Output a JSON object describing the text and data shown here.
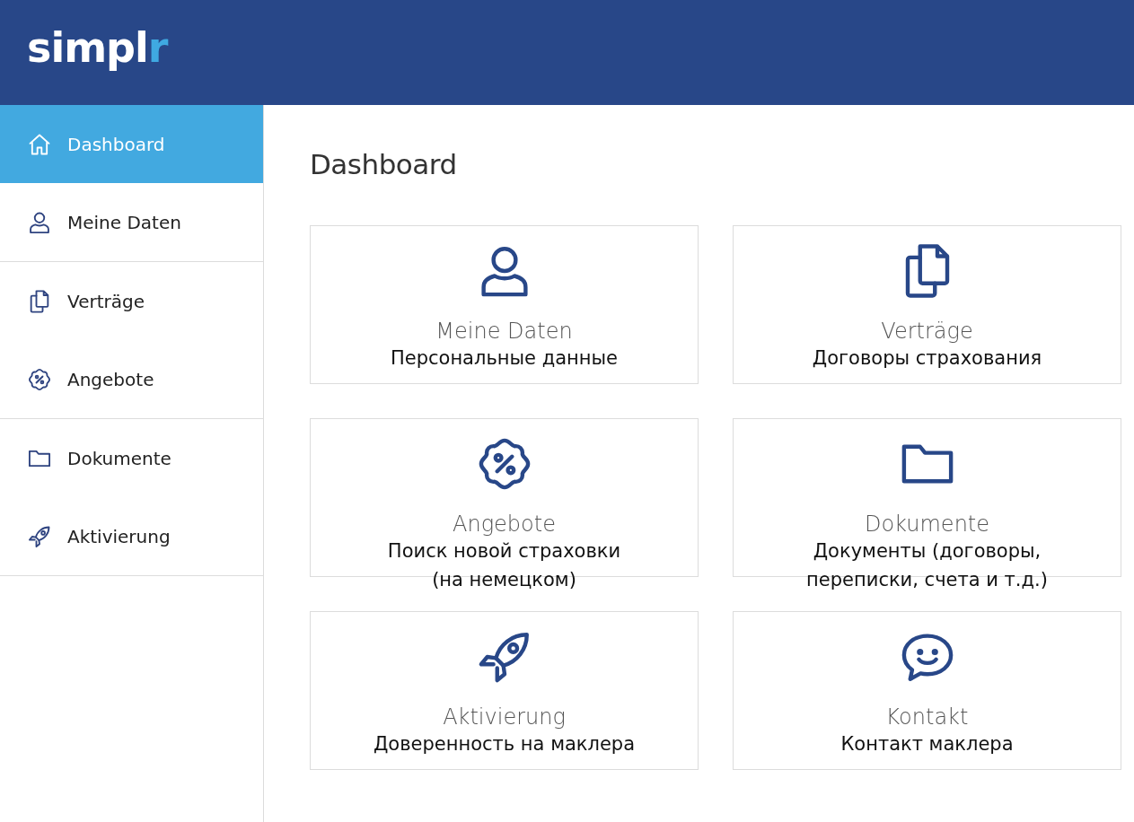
{
  "logo": {
    "main": "simpl",
    "accent": "r"
  },
  "sidebar": {
    "groups": [
      {
        "items": [
          {
            "kind": "home",
            "label": "Dashboard",
            "selected": true
          },
          {
            "kind": "user",
            "label": "Meine Daten",
            "selected": false
          }
        ]
      },
      {
        "items": [
          {
            "kind": "copy",
            "label": "Verträge",
            "selected": false
          },
          {
            "kind": "percent",
            "label": "Angebote",
            "selected": false
          }
        ]
      },
      {
        "items": [
          {
            "kind": "folder",
            "label": "Dokumente",
            "selected": false
          },
          {
            "kind": "rocket",
            "label": "Aktivierung",
            "selected": false
          }
        ]
      }
    ]
  },
  "page_title": "Dashboard",
  "cards": [
    {
      "kind": "user",
      "title": "Meine Daten",
      "subtitle": "Персональные данные"
    },
    {
      "kind": "copy",
      "title": "Verträge",
      "subtitle": "Договоры страхования"
    },
    {
      "kind": "percent",
      "title": "Angebote",
      "subtitle": "Поиск новой страховки\n(на немецком)"
    },
    {
      "kind": "folder",
      "title": "Dokumente",
      "subtitle": "Документы (договоры,\nпереписки, счета и т.д.)"
    },
    {
      "kind": "rocket",
      "title": "Aktivierung",
      "subtitle": "Доверенность на маклера"
    },
    {
      "kind": "chat",
      "title": "Kontakt",
      "subtitle": "Контакт маклера"
    }
  ]
}
